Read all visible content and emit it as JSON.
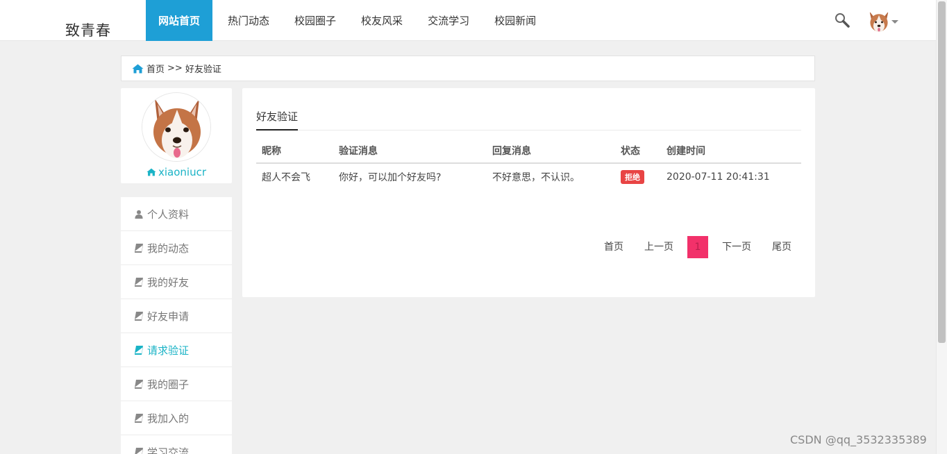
{
  "header": {
    "logo": "致青春",
    "nav": [
      "网站首页",
      "热门动态",
      "校园圈子",
      "校友风采",
      "交流学习",
      "校园新闻"
    ],
    "active_nav": 0
  },
  "breadcrumb": {
    "home": "首页",
    "sep": ">>",
    "current": "好友验证"
  },
  "profile": {
    "username": "xiaoniucr"
  },
  "menu": {
    "items": [
      "个人资料",
      "我的动态",
      "我的好友",
      "好友申请",
      "请求验证",
      "我的圈子",
      "我加入的",
      "学习交流"
    ],
    "active": 4
  },
  "panel": {
    "tab": "好友验证",
    "columns": [
      "昵称",
      "验证消息",
      "回复消息",
      "状态",
      "创建时间"
    ],
    "rows": [
      {
        "nickname": "超人不会飞",
        "message": "你好，可以加个好友吗?",
        "reply": "不好意思，不认识。",
        "status": "拒绝",
        "created": "2020-07-11 20:41:31"
      }
    ],
    "pager": {
      "first": "首页",
      "prev": "上一页",
      "current": "1",
      "next": "下一页",
      "last": "尾页"
    }
  },
  "watermark": "CSDN @qq_3532335389",
  "colors": {
    "accent": "#1e9fd6",
    "teal": "#1ab3c6",
    "reject": "#e84444",
    "page_current": "#f2316a"
  }
}
